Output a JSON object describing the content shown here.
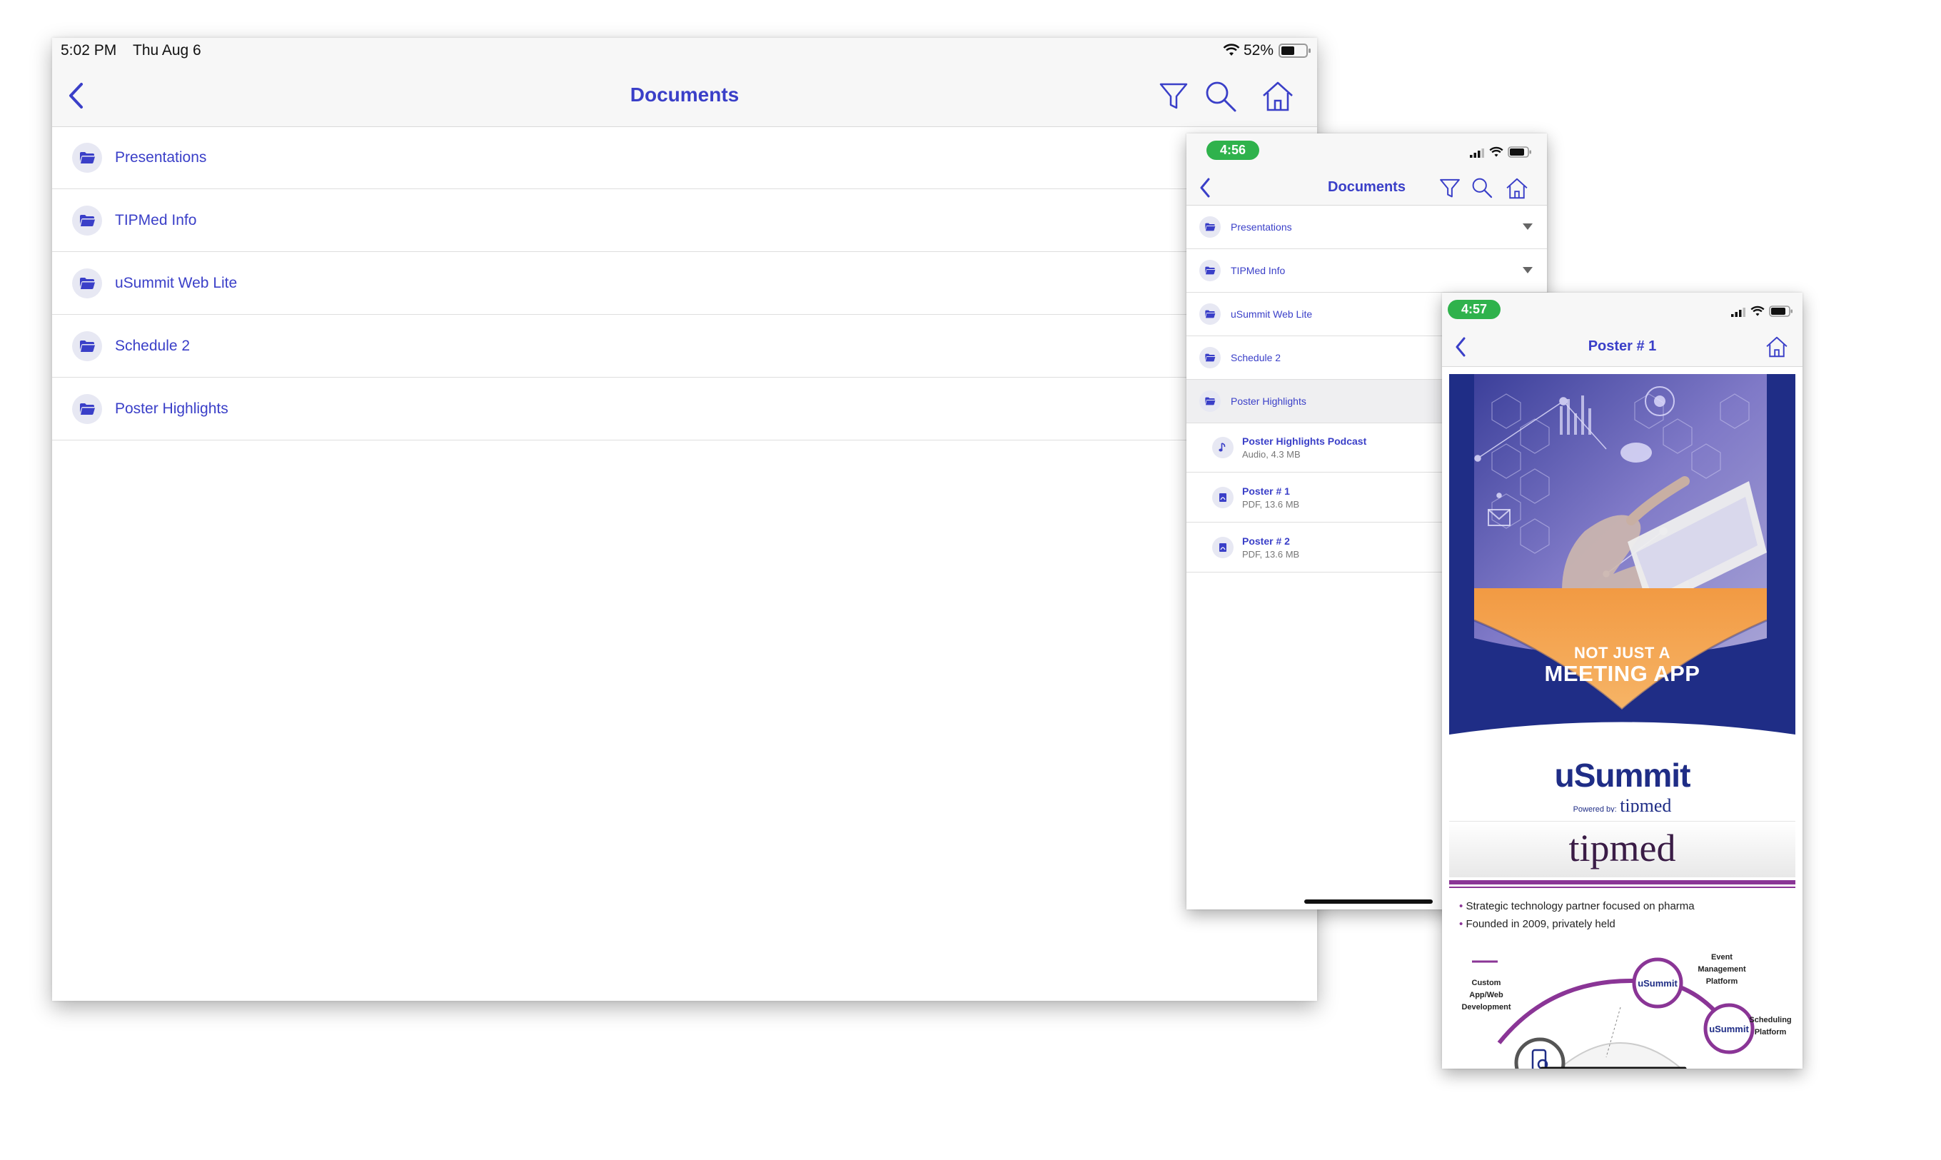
{
  "ipad": {
    "status": {
      "time": "5:02 PM",
      "date": "Thu Aug 6",
      "battery": "52%"
    },
    "nav": {
      "title": "Documents"
    },
    "folders": [
      {
        "label": "Presentations"
      },
      {
        "label": "TIPMed Info"
      },
      {
        "label": "uSummit Web Lite"
      },
      {
        "label": "Schedule 2"
      },
      {
        "label": "Poster Highlights"
      }
    ]
  },
  "phone_list": {
    "status": {
      "time": "4:56"
    },
    "nav": {
      "title": "Documents"
    },
    "folders": [
      {
        "label": "Presentations"
      },
      {
        "label": "TIPMed Info"
      },
      {
        "label": "uSummit Web Lite"
      },
      {
        "label": "Schedule 2"
      },
      {
        "label": "Poster Highlights"
      }
    ],
    "files": [
      {
        "name": "Poster Highlights Podcast",
        "meta": "Audio, 4.3 MB",
        "icon": "music-note-icon"
      },
      {
        "name": "Poster # 1",
        "meta": "PDF, 13.6 MB",
        "icon": "pdf-icon"
      },
      {
        "name": "Poster # 2",
        "meta": "PDF, 13.6 MB",
        "icon": "pdf-icon"
      }
    ]
  },
  "phone_viewer": {
    "status": {
      "time": "4:57"
    },
    "nav": {
      "title": "Poster # 1"
    },
    "poster": {
      "headline_small": "NOT JUST A",
      "headline_large": "MEETING APP",
      "brand": "uSummit",
      "powered_by": "Powered by:",
      "powered_brand": "tipmed"
    },
    "slide2": {
      "logo": "tipmed",
      "bullets": [
        "Strategic technology partner focused on pharma",
        "Founded in 2009, privately held"
      ],
      "labels": {
        "custom": "Custom\nApp/Web\nDevelopment",
        "event": "Event\nManagement\nPlatform",
        "scheduling": "Scheduling\nPlatform"
      }
    }
  },
  "colors": {
    "accent": "#3a3fc8",
    "pill_green": "#2fb24c",
    "orange": "#f4a04a",
    "navy": "#1f2d86",
    "purple": "#8a3596"
  }
}
